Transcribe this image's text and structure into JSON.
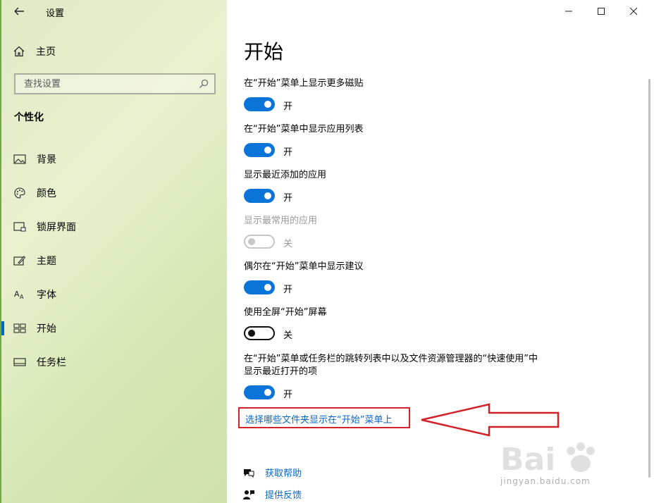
{
  "window": {
    "title": "设置"
  },
  "sidebar": {
    "home_label": "主页",
    "search_placeholder": "查找设置",
    "section_title": "个性化",
    "items": [
      {
        "label": "背景",
        "icon": "picture-icon"
      },
      {
        "label": "颜色",
        "icon": "palette-icon"
      },
      {
        "label": "锁屏界面",
        "icon": "lock-screen-icon"
      },
      {
        "label": "主题",
        "icon": "theme-brush-icon"
      },
      {
        "label": "字体",
        "icon": "font-icon"
      },
      {
        "label": "开始",
        "icon": "start-icon",
        "active": true
      },
      {
        "label": "任务栏",
        "icon": "taskbar-icon"
      }
    ]
  },
  "main": {
    "title": "开始",
    "settings": [
      {
        "label": "在“开始”菜单上显示更多磁贴",
        "state": "开",
        "on": true,
        "disabled": false
      },
      {
        "label": "在“开始”菜单中显示应用列表",
        "state": "开",
        "on": true,
        "disabled": false
      },
      {
        "label": "显示最近添加的应用",
        "state": "开",
        "on": true,
        "disabled": false
      },
      {
        "label": "显示最常用的应用",
        "state": "关",
        "on": false,
        "disabled": true
      },
      {
        "label": "偶尔在“开始”菜单中显示建议",
        "state": "开",
        "on": true,
        "disabled": false
      },
      {
        "label": "使用全屏“开始”屏幕",
        "state": "关",
        "on": false,
        "disabled": false
      },
      {
        "label_line1": "在“开始”菜单或任务栏的跳转列表中以及文件资源管理器的“快速使用”中",
        "label_line2": "显示最近打开的项",
        "state": "开",
        "on": true,
        "disabled": false
      }
    ],
    "folders_link": "选择哪些文件夹显示在“开始”菜单上",
    "help_link": "获取帮助",
    "feedback_link": "提供反馈"
  },
  "watermark": {
    "text": "jingyan.baidu.com"
  },
  "colors": {
    "accent": "#0b74d9",
    "link": "#0a66c2",
    "highlight_red": "#d2222a",
    "sidebar_green": "#d6e6b3"
  }
}
